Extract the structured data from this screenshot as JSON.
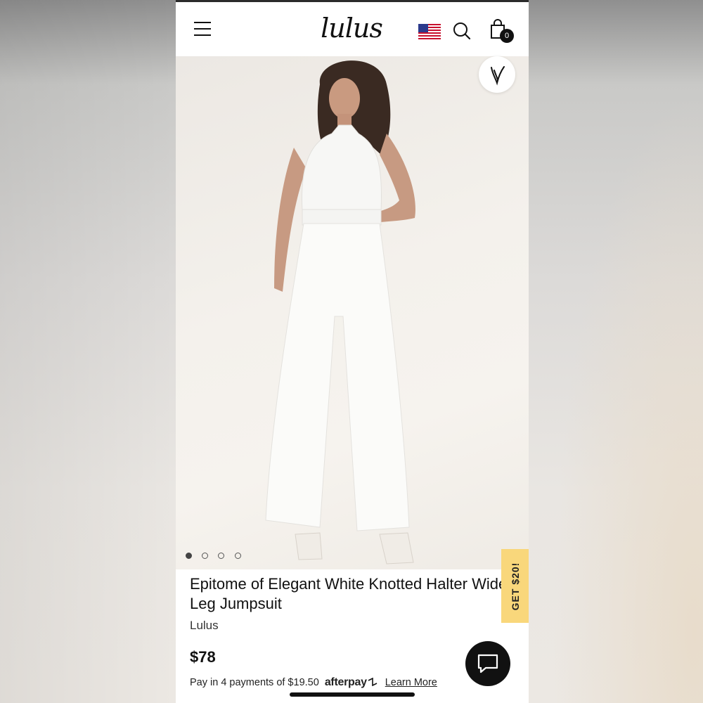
{
  "header": {
    "logo_text": "lulus",
    "menu_icon": "hamburger-menu-icon",
    "flag_icon": "us-flag-icon",
    "search_icon": "search-icon",
    "cart_icon": "shopping-bag-icon",
    "cart_count": "0"
  },
  "gallery": {
    "image_alt": "Model wearing white halter wide-leg jumpsuit",
    "favorite_icon": "heart-icon",
    "dots_total": 4,
    "active_dot": 1
  },
  "product": {
    "title": "Epitome of Elegant White Knotted Halter Wide-Leg Jumpsuit",
    "brand": "Lulus",
    "price": "$78"
  },
  "afterpay": {
    "text": "Pay in 4 payments of $19.50",
    "logo_text": "afterpay",
    "learn_more": "Learn More"
  },
  "promo": {
    "label": "GET $20!"
  },
  "chat": {
    "icon": "chat-bubble-icon"
  },
  "colors": {
    "promo_bg": "#f9d77b",
    "accent": "#111111"
  }
}
